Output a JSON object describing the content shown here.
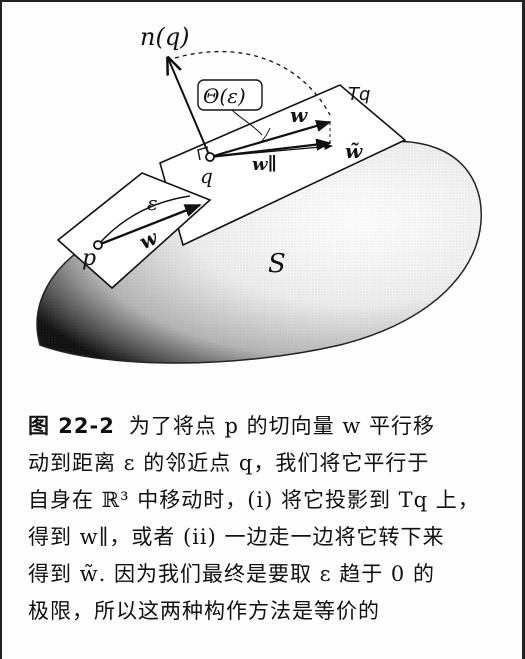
{
  "figure": {
    "labels": {
      "normal": "n(q)",
      "angle": "Θ(ε)",
      "tangent_plane": "Tq",
      "point_q": "q",
      "point_p": "p",
      "vec_w_p": "w",
      "vec_w_q": "w",
      "vec_w_parallel": "w∥",
      "vec_w_tilde": "w̃",
      "epsilon": "ε",
      "surface": "S"
    }
  },
  "caption": {
    "figure_number": "图 22-2",
    "lines": [
      "为了将点 p 的切向量 w 平行移",
      "动到距离 ε 的邻近点 q，我们将它平行于",
      "自身在 ℝ³ 中移动时，(i) 将它投影到 Tq 上，",
      "得到 w∥，或者 (ii) 一边走一边将它转下来",
      "得到 w̃. 因为我们最终是要取 ε 趋于 0 的",
      "极限，所以这两种构作方法是等价的"
    ]
  }
}
